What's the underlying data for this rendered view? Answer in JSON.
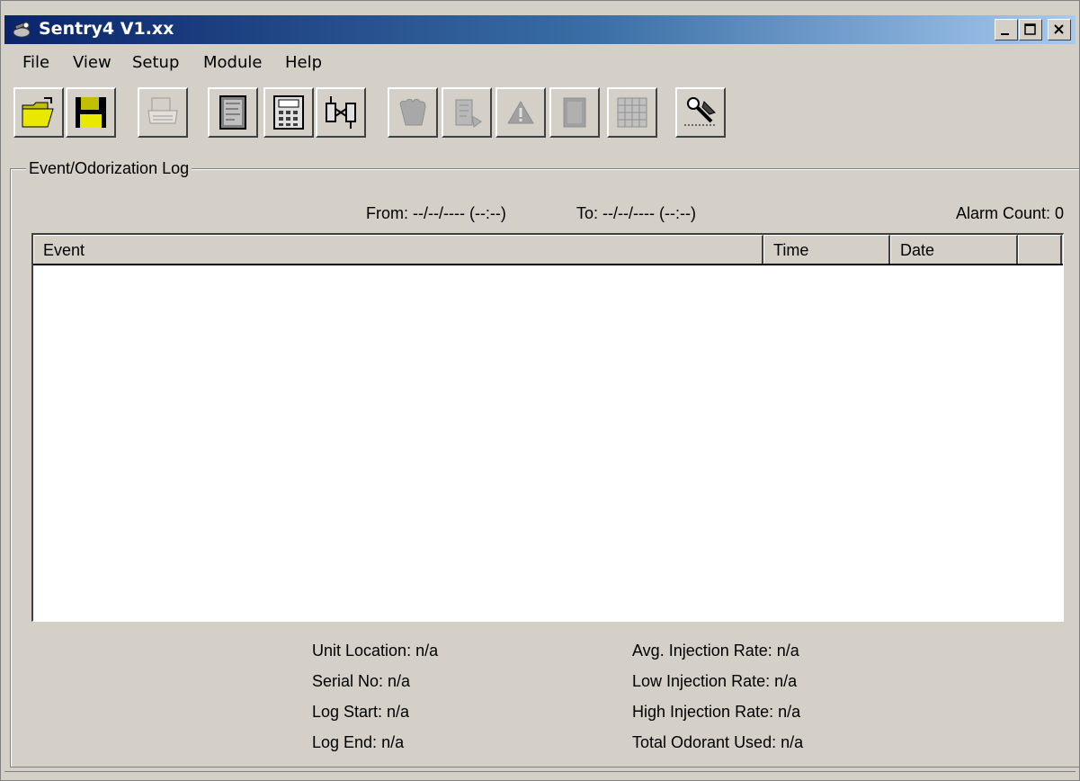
{
  "window": {
    "title": "Sentry4 V1.xx"
  },
  "menu": {
    "items": [
      "File",
      "View",
      "Setup",
      "Module",
      "Help"
    ]
  },
  "toolbar": {
    "buttons": [
      {
        "icon": "open-folder-icon",
        "enabled": true
      },
      {
        "icon": "save-disk-icon",
        "enabled": true
      },
      {
        "icon": "printer-icon",
        "enabled": false
      },
      {
        "icon": "document-icon",
        "enabled": true
      },
      {
        "icon": "calculator-icon",
        "enabled": true
      },
      {
        "icon": "connect-plug-icon",
        "enabled": true
      },
      {
        "icon": "hand-icon",
        "enabled": false
      },
      {
        "icon": "chart-doc-icon",
        "enabled": false
      },
      {
        "icon": "warning-triangle-icon",
        "enabled": false
      },
      {
        "icon": "memory-card-icon",
        "enabled": false
      },
      {
        "icon": "grid-icon",
        "enabled": false
      },
      {
        "icon": "tools-icon",
        "enabled": true
      }
    ]
  },
  "log": {
    "group_title": "Event/Odorization Log",
    "from_label": "From: --/--/---- (--:--)",
    "to_label": "To: --/--/---- (--:--)",
    "alarm_count": "Alarm Count: 0",
    "columns": [
      "Event",
      "Time",
      "Date",
      ""
    ],
    "rows": []
  },
  "stats": {
    "unit_location": "Unit Location: n/a",
    "serial_no": "Serial No: n/a",
    "log_start": "Log Start: n/a",
    "log_end": "Log End: n/a",
    "avg_injection_rate": "Avg. Injection Rate: n/a",
    "low_injection_rate": "Low Injection Rate: n/a",
    "high_injection_rate": "High Injection Rate: n/a",
    "total_odorant_used": "Total Odorant Used: n/a"
  },
  "colors": {
    "titlebar_start": "#0a246a",
    "titlebar_end": "#a6caf0",
    "face": "#d4d0c8"
  }
}
